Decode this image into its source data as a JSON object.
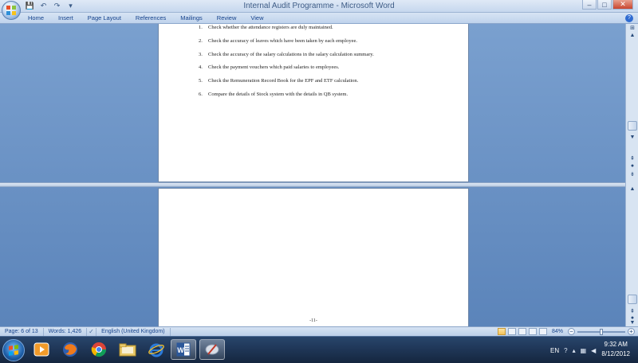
{
  "window": {
    "title": "Internal Audit Programme - Microsoft Word",
    "controls": {
      "minimize": "–",
      "maximize": "□",
      "close": "✕"
    }
  },
  "quick_access": {
    "save": "💾",
    "undo": "↶",
    "redo": "↷",
    "customize": "▾"
  },
  "ribbon": {
    "tabs": [
      "Home",
      "Insert",
      "Page Layout",
      "References",
      "Mailings",
      "Review",
      "View"
    ],
    "help": "?"
  },
  "document": {
    "items": [
      {
        "num": "1.",
        "text": "Check whether the attendance registers are duly maintained."
      },
      {
        "num": "2.",
        "text": "Check the accuracy of leaves which have been taken by each employee."
      },
      {
        "num": "3.",
        "text": "Check the accuracy of the salary calculations in the salary calculation summary."
      },
      {
        "num": "4.",
        "text": "Check the payment vouchers which paid salaries to employees."
      },
      {
        "num": "5.",
        "text": "Check the Remuneration Record Book for the EPF and ETF calculation."
      },
      {
        "num": "6.",
        "text": "Compare the details of Stock system with the details in QB system."
      }
    ],
    "page_footer": "-11-"
  },
  "status": {
    "page": "Page: 6 of 13",
    "words": "Words: 1,426",
    "language": "English (United Kingdom)",
    "zoom": "84%",
    "zoom_out": "−",
    "zoom_in": "+"
  },
  "taskbar": {
    "lang": "EN",
    "time": "9:32 AM",
    "date": "8/12/2012"
  },
  "colors": {
    "accent": "#15428b",
    "ribbon": "#c6d7ee",
    "workspace": "#6a90c4"
  }
}
